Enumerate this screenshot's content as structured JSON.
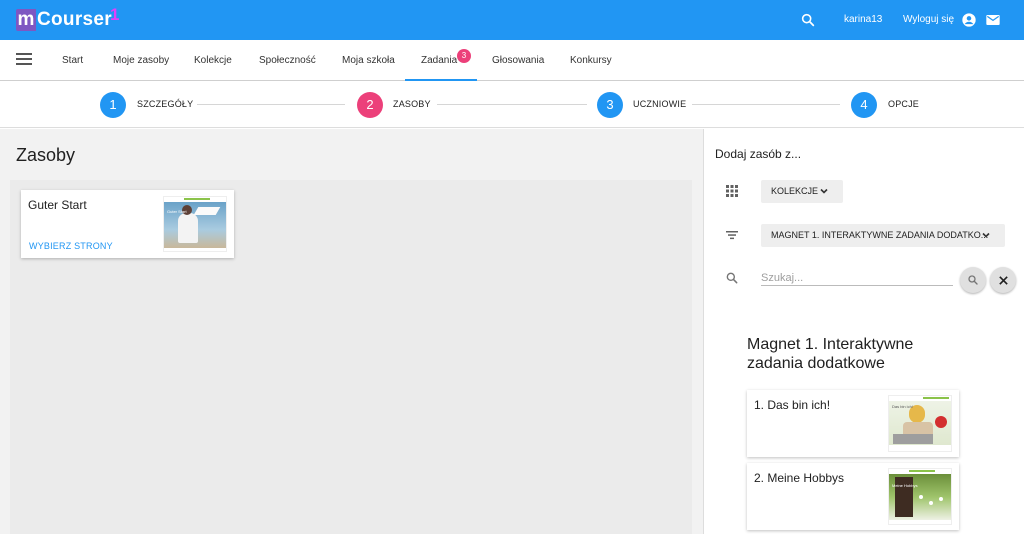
{
  "app": {
    "logo_letter": "m",
    "logo_name": "Courser",
    "logo_superscript": "1"
  },
  "topbar": {
    "username": "karina13",
    "logout_label": "Wyloguj się"
  },
  "nav": {
    "items": [
      {
        "label": "Start"
      },
      {
        "label": "Moje zasoby"
      },
      {
        "label": "Kolekcje"
      },
      {
        "label": "Społeczność"
      },
      {
        "label": "Moja szkoła"
      },
      {
        "label": "Zadania",
        "badge": "3"
      },
      {
        "label": "Głosowania"
      },
      {
        "label": "Konkursy"
      }
    ]
  },
  "stepper": {
    "steps": [
      {
        "number": "1",
        "label": "SZCZEGÓŁY",
        "color": "#2196f3"
      },
      {
        "number": "2",
        "label": "ZASOBY",
        "color": "#ec407a"
      },
      {
        "number": "3",
        "label": "UCZNIOWIE",
        "color": "#2196f3"
      },
      {
        "number": "4",
        "label": "OPCJE",
        "color": "#2196f3"
      }
    ]
  },
  "resources": {
    "title": "Zasoby",
    "cards": [
      {
        "title": "Guter Start",
        "action": "WYBIERZ STRONY",
        "thumb_text": "Guter Start"
      }
    ]
  },
  "add_panel": {
    "heading": "Dodaj zasób z...",
    "source_dropdown": "KOLEKCJE",
    "filter_dropdown": "MAGNET 1. INTERAKTYWNE ZADANIA DODATKO...",
    "search_placeholder": "Szukaj...",
    "collection_title": "Magnet 1. Interaktywne zadania dodatkowe",
    "items": [
      {
        "title": "1. Das bin ich!",
        "thumb_text": "Das bin ich!"
      },
      {
        "title": "2. Meine Hobbys",
        "thumb_text": "Meine Hobbys"
      }
    ]
  },
  "icons": {
    "search": "search-icon",
    "account": "account-circle-icon",
    "mail": "mail-icon",
    "menu": "menu-icon",
    "apps": "apps-icon",
    "filter": "filter-list-icon",
    "chevron": "chevron-down-icon",
    "close": "close-icon"
  },
  "colors": {
    "primary": "#2196f3",
    "accent": "#ec407a",
    "logo_box": "#7e57c2"
  }
}
